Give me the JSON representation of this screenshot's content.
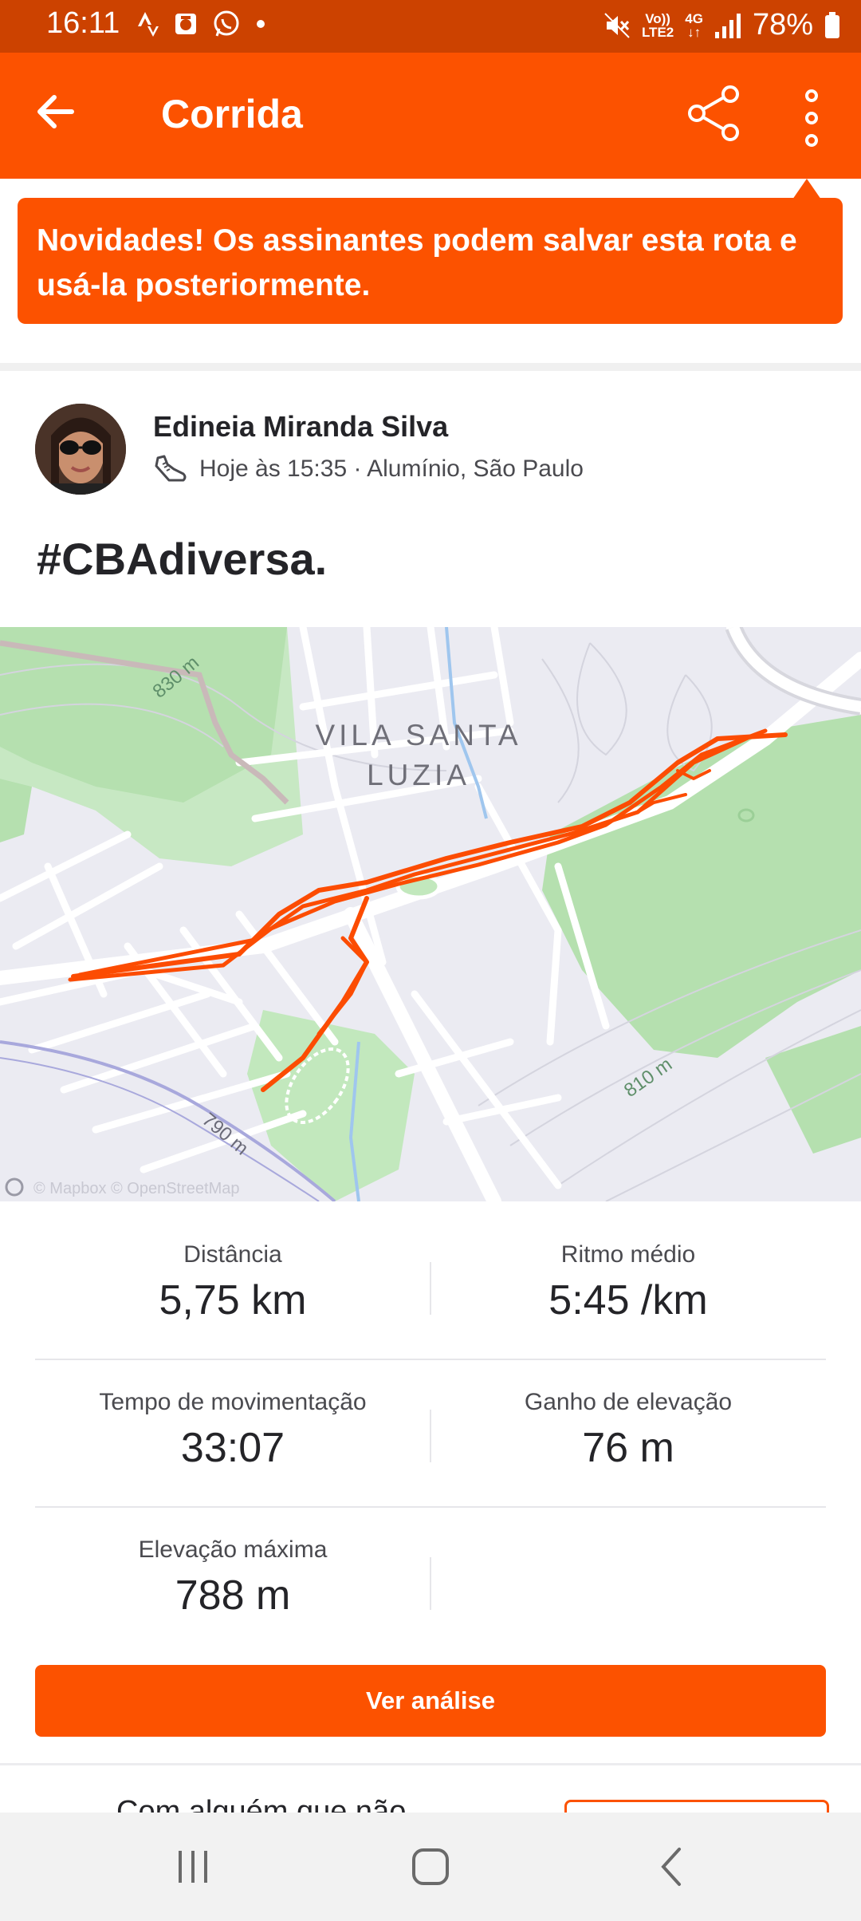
{
  "status_bar": {
    "time": "16:11",
    "network_top": "Vo))",
    "network_bottom": "LTE2",
    "data_top": "4G",
    "data_bottom": "↓↑",
    "battery": "78%"
  },
  "app_bar": {
    "title": "Corrida"
  },
  "banner": {
    "text": "Novidades! Os assinantes podem salvar esta rota e usá-la posteriormente."
  },
  "activity": {
    "athlete_name": "Edineia Miranda Silva",
    "meta": "Hoje às 15:35 · Alumínio, São Paulo",
    "title": "#CBAdiversa."
  },
  "map": {
    "neighborhood_line1": "VILA SANTA",
    "neighborhood_line2": "LUZIA",
    "contour_labels": [
      "830 m",
      "810 m",
      "790 m"
    ],
    "attribution": "© Mapbox © OpenStreetMap",
    "route_color": "#fc4c02"
  },
  "stats": [
    {
      "label": "Distância",
      "value": "5,75 km"
    },
    {
      "label": "Ritmo médio",
      "value": "5:45 /km"
    },
    {
      "label": "Tempo de movimentação",
      "value": "33:07"
    },
    {
      "label": "Ganho de elevação",
      "value": "76 m"
    },
    {
      "label": "Elevação máxima",
      "value": "788 m"
    }
  ],
  "analysis_button": "Ver análise",
  "partial_text": "Com alguém que não",
  "colors": {
    "brand": "#fc5200",
    "status_bar": "#cc4200"
  }
}
